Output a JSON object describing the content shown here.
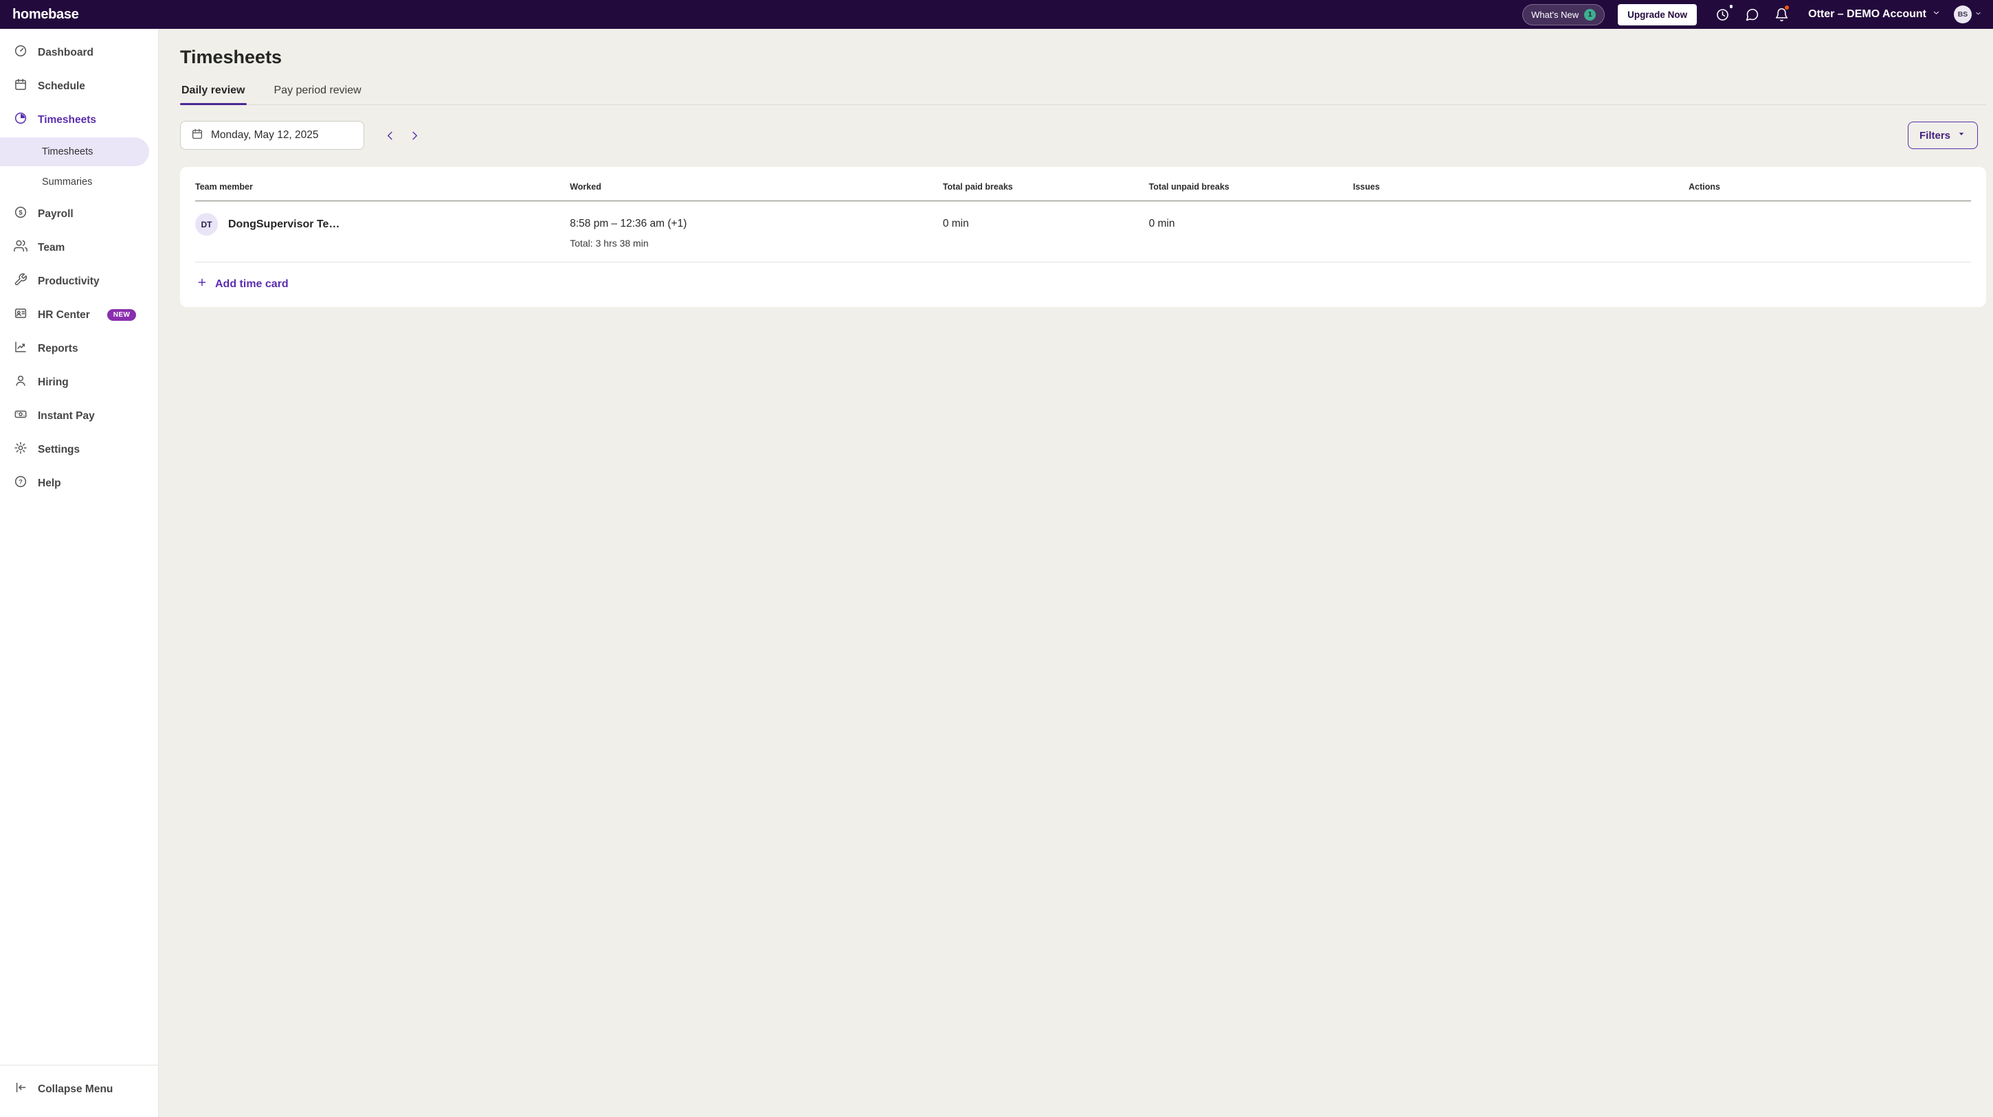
{
  "topbar": {
    "logo": "homebase",
    "whats_new": {
      "label": "What's New",
      "badge": "1"
    },
    "upgrade_label": "Upgrade Now",
    "account_label": "Otter – DEMO Account",
    "avatar_initials": "BS"
  },
  "sidebar": {
    "items": [
      {
        "label": "Dashboard"
      },
      {
        "label": "Schedule"
      },
      {
        "label": "Timesheets"
      },
      {
        "label": "Payroll"
      },
      {
        "label": "Team"
      },
      {
        "label": "Productivity"
      },
      {
        "label": "HR Center",
        "badge": "NEW"
      },
      {
        "label": "Reports"
      },
      {
        "label": "Hiring"
      },
      {
        "label": "Instant Pay"
      },
      {
        "label": "Settings"
      },
      {
        "label": "Help"
      }
    ],
    "sub_items": [
      {
        "label": "Timesheets"
      },
      {
        "label": "Summaries"
      }
    ],
    "collapse_label": "Collapse Menu"
  },
  "main": {
    "title": "Timesheets",
    "tabs": [
      {
        "label": "Daily review"
      },
      {
        "label": "Pay period review"
      }
    ],
    "date_label": "Monday, May 12, 2025",
    "filters_label": "Filters",
    "table": {
      "headers": [
        "Team member",
        "Worked",
        "Total paid breaks",
        "Total unpaid breaks",
        "Issues",
        "Actions"
      ],
      "rows": [
        {
          "initials": "DT",
          "name": "DongSupervisor Te…",
          "worked_range": "8:58 pm – 12:36 am (+1)",
          "worked_total": "Total: 3 hrs 38 min",
          "total_paid_breaks": "0 min",
          "total_unpaid_breaks": "0 min"
        }
      ],
      "add_time_card_label": "Add time card"
    }
  },
  "colors": {
    "accent_purple": "#5b2eae",
    "topbar_bg": "#230a3d",
    "whats_new_badge_green": "#3fae92",
    "new_badge_purple": "#8a2fae",
    "notification_dot_orange": "#f1580c",
    "main_bg": "#f0efe9",
    "selected_subitem_bg": "#ebe5f8"
  }
}
